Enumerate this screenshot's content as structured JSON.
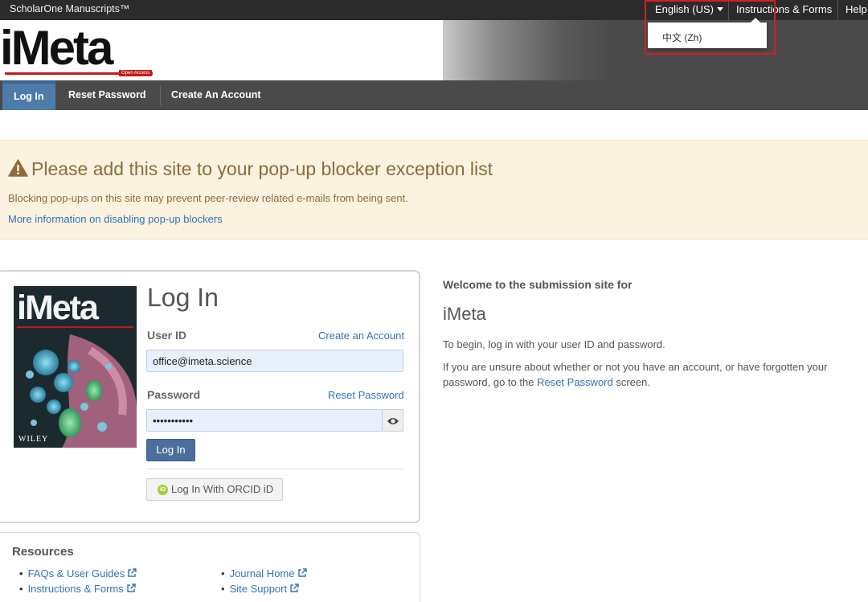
{
  "topbar": {
    "brand": "ScholarOne Manuscripts™",
    "language": "English (US)",
    "instructions": "Instructions & Forms",
    "help": "Help"
  },
  "header": {
    "logo_text": "iMeta",
    "logo_badge": "Open Access"
  },
  "language_menu": {
    "items": [
      "中文 (Zh)"
    ]
  },
  "nav": {
    "items": [
      "Log In",
      "Reset Password",
      "Create An Account"
    ],
    "active": "Log In"
  },
  "alert": {
    "title": "Please add this site to your pop-up blocker exception list",
    "text": "Blocking pop-ups on this site may prevent peer-review related e-mails from being sent.",
    "link": "More information on disabling pop-up blockers"
  },
  "login": {
    "cover_title": "iMeta",
    "cover_publisher": "WILEY",
    "title": "Log In",
    "userid_label": "User ID",
    "create_link": "Create an Account",
    "userid_value": "office@imeta.science",
    "password_label": "Password",
    "reset_link": "Reset Password",
    "password_value": "•••••••••••",
    "login_button": "Log In",
    "orcid_button": "Log In With ORCID iD",
    "orcid_icon_text": "iD"
  },
  "resources": {
    "title": "Resources",
    "left": [
      "FAQs & User Guides",
      "Instructions & Forms"
    ],
    "right": [
      "Journal Home",
      "Site Support"
    ]
  },
  "welcome": {
    "heading": "Welcome to the submission site for",
    "journal": "iMeta",
    "para1": "To begin, log in with your user ID and password.",
    "para2_before": "If you are unsure about whether or not you have an account, or have forgotten your password, go to the ",
    "para2_link": "Reset Password",
    "para2_after": " screen."
  },
  "colors": {
    "nav_bg": "#4a4a4a",
    "nav_active": "#4d7ca8",
    "link": "#2f74b5",
    "alert_bg": "#fcf2e0",
    "alert_text": "#8a6d3b",
    "brand_red": "#c21a1a",
    "highlight": "#d41e25"
  }
}
